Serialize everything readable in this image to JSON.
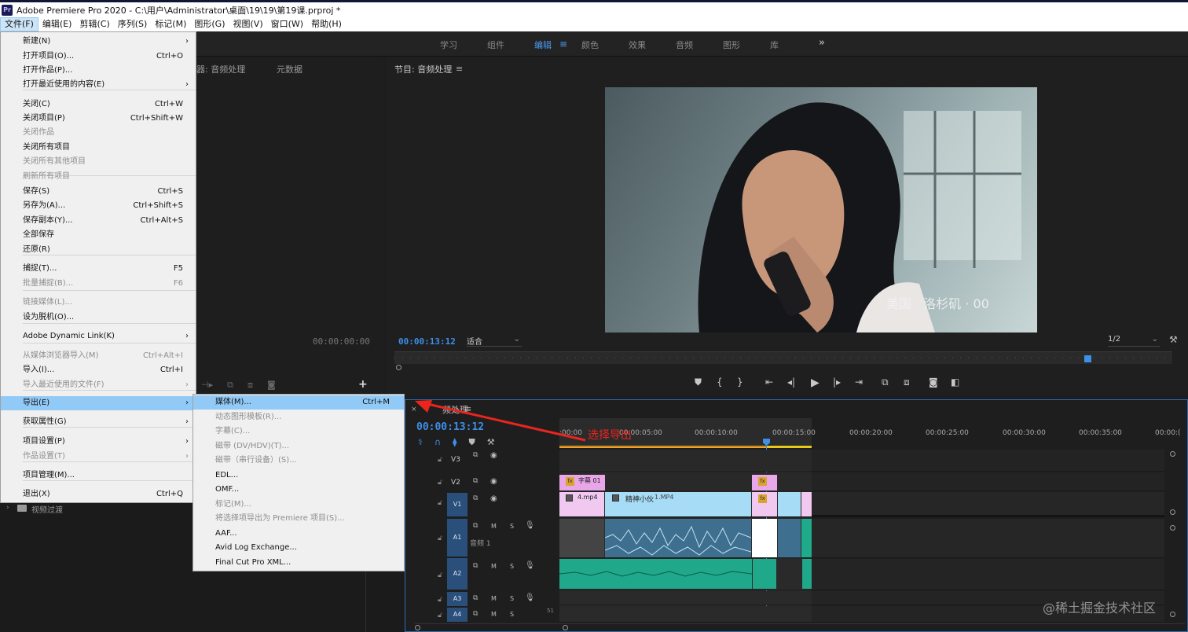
{
  "window": {
    "title": "Adobe Premiere Pro 2020 - C:\\用户\\Administrator\\桌面\\19\\19\\第19课.prproj *",
    "logo": "Pr"
  },
  "menubar": [
    "文件(F)",
    "编辑(E)",
    "剪辑(C)",
    "序列(S)",
    "标记(M)",
    "图形(G)",
    "视图(V)",
    "窗口(W)",
    "帮助(H)"
  ],
  "workspaces": {
    "items": [
      "学习",
      "组件",
      "编辑",
      "颜色",
      "效果",
      "音频",
      "图形",
      "库"
    ],
    "active": "编辑",
    "more": "»"
  },
  "source_panel": {
    "tab_source": "器: 音频处理",
    "tab_meta": "元数据",
    "timecode": "00:00:00:00"
  },
  "effects_panel": {
    "folder": "视频过渡"
  },
  "program_monitor": {
    "title": "节目: 音频处理",
    "timecode": "00:00:13:12",
    "fit": "适合",
    "resolution": "1/2",
    "video_caption": "美国 · 洛杉矶 · 00"
  },
  "file_menu": {
    "items": [
      {
        "label": "新建(N)",
        "shortcut": "",
        "submenu": true,
        "disabled": false
      },
      {
        "label": "打开项目(O)...",
        "shortcut": "Ctrl+O",
        "submenu": false,
        "disabled": false
      },
      {
        "label": "打开作品(P)...",
        "shortcut": "",
        "submenu": false,
        "disabled": false
      },
      {
        "label": "打开最近使用的内容(E)",
        "shortcut": "",
        "submenu": true,
        "disabled": false
      },
      {
        "label": "关闭(C)",
        "shortcut": "Ctrl+W",
        "submenu": false,
        "disabled": false
      },
      {
        "label": "关闭项目(P)",
        "shortcut": "Ctrl+Shift+W",
        "submenu": false,
        "disabled": false
      },
      {
        "label": "关闭作品",
        "shortcut": "",
        "submenu": false,
        "disabled": true
      },
      {
        "label": "关闭所有项目",
        "shortcut": "",
        "submenu": false,
        "disabled": false
      },
      {
        "label": "关闭所有其他项目",
        "shortcut": "",
        "submenu": false,
        "disabled": true
      },
      {
        "label": "刷新所有项目",
        "shortcut": "",
        "submenu": false,
        "disabled": true
      },
      {
        "label": "保存(S)",
        "shortcut": "Ctrl+S",
        "submenu": false,
        "disabled": false
      },
      {
        "label": "另存为(A)...",
        "shortcut": "Ctrl+Shift+S",
        "submenu": false,
        "disabled": false
      },
      {
        "label": "保存副本(Y)...",
        "shortcut": "Ctrl+Alt+S",
        "submenu": false,
        "disabled": false
      },
      {
        "label": "全部保存",
        "shortcut": "",
        "submenu": false,
        "disabled": false
      },
      {
        "label": "还原(R)",
        "shortcut": "",
        "submenu": false,
        "disabled": false
      },
      {
        "label": "捕捉(T)...",
        "shortcut": "F5",
        "submenu": false,
        "disabled": false
      },
      {
        "label": "批量捕捉(B)...",
        "shortcut": "F6",
        "submenu": false,
        "disabled": true
      },
      {
        "label": "链接媒体(L)...",
        "shortcut": "",
        "submenu": false,
        "disabled": true
      },
      {
        "label": "设为脱机(O)...",
        "shortcut": "",
        "submenu": false,
        "disabled": false
      },
      {
        "label": "Adobe Dynamic Link(K)",
        "shortcut": "",
        "submenu": true,
        "disabled": false
      },
      {
        "label": "从媒体浏览器导入(M)",
        "shortcut": "Ctrl+Alt+I",
        "submenu": false,
        "disabled": true
      },
      {
        "label": "导入(I)...",
        "shortcut": "Ctrl+I",
        "submenu": false,
        "disabled": false
      },
      {
        "label": "导入最近使用的文件(F)",
        "shortcut": "",
        "submenu": true,
        "disabled": true
      },
      {
        "label": "导出(E)",
        "shortcut": "",
        "submenu": true,
        "disabled": false,
        "highlight": true
      },
      {
        "label": "获取属性(G)",
        "shortcut": "",
        "submenu": true,
        "disabled": false
      },
      {
        "label": "项目设置(P)",
        "shortcut": "",
        "submenu": true,
        "disabled": false
      },
      {
        "label": "作品设置(T)",
        "shortcut": "",
        "submenu": true,
        "disabled": true
      },
      {
        "label": "项目管理(M)...",
        "shortcut": "",
        "submenu": false,
        "disabled": false
      },
      {
        "label": "退出(X)",
        "shortcut": "Ctrl+Q",
        "submenu": false,
        "disabled": false
      }
    ]
  },
  "export_menu": {
    "items": [
      {
        "label": "媒体(M)...",
        "shortcut": "Ctrl+M",
        "disabled": false,
        "highlight": true
      },
      {
        "label": "动态图形模板(R)...",
        "shortcut": "",
        "disabled": true
      },
      {
        "label": "字幕(C)...",
        "shortcut": "",
        "disabled": true
      },
      {
        "label": "磁带 (DV/HDV)(T)...",
        "shortcut": "",
        "disabled": true
      },
      {
        "label": "磁带（串行设备）(S)...",
        "shortcut": "",
        "disabled": true
      },
      {
        "label": "EDL...",
        "shortcut": "",
        "disabled": false
      },
      {
        "label": "OMF...",
        "shortcut": "",
        "disabled": false
      },
      {
        "label": "标记(M)...",
        "shortcut": "",
        "disabled": true
      },
      {
        "label": "将选择项导出为 Premiere 项目(S)...",
        "shortcut": "",
        "disabled": true
      },
      {
        "label": "AAF...",
        "shortcut": "",
        "disabled": false
      },
      {
        "label": "Avid Log Exchange...",
        "shortcut": "",
        "disabled": false
      },
      {
        "label": "Final Cut Pro XML...",
        "shortcut": "",
        "disabled": false
      }
    ]
  },
  "annotation": {
    "text": "选择导出",
    "color": "#e8251e"
  },
  "timeline": {
    "tab": "频处理",
    "timecode": "00:00:13:12",
    "ruler": [
      ":00:00",
      "00:00:05:00",
      "00:00:10:00",
      "00:00:15:00",
      "00:00:20:00",
      "00:00:25:00",
      "00:00:30:00",
      "00:00:35:00",
      "00:00:("
    ],
    "tracks": {
      "v3": "V3",
      "v2": "V2",
      "v1": "V1",
      "a1": "A1",
      "a2": "A2",
      "a3": "A3",
      "a4": "A4",
      "a1_name": "音频 1",
      "m": "M",
      "s": "S",
      "a4_vol": "51"
    },
    "clips": {
      "subtitle": "字幕 01",
      "clip_4mp4": "4.mp4",
      "clip_1mp4_a": "精神小伙",
      "clip_1mp4_b": "1.MP4",
      "fx": "fx"
    }
  },
  "watermark": "@稀土掘金技术社区",
  "colors": {
    "accent_blue": "#3d8fe8",
    "clip_pink": "#f0c8f0",
    "clip_cyan": "#a6dcf5",
    "audio_clip": "#3a7a9a",
    "audio_clip2": "#1faa8c"
  }
}
